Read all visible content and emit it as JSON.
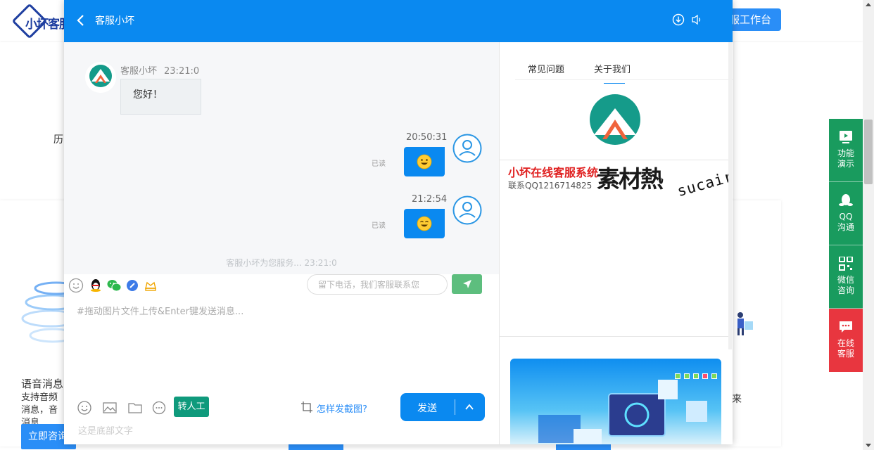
{
  "background_site": {
    "logo_text": "小坏客服",
    "console_button": "服工作台",
    "left_snippet": "历",
    "feature_title": "语音消息",
    "feature_desc": "支持音频消息，音消息",
    "consult_button": "立即咨询",
    "right_char": "来"
  },
  "float_bar": {
    "items": [
      {
        "icon": "play-icon",
        "label_1": "功能",
        "label_2": "演示"
      },
      {
        "icon": "qq-icon",
        "label_1": "QQ",
        "label_2": "沟通"
      },
      {
        "icon": "qr-code-icon",
        "label_1": "微信",
        "label_2": "咨询"
      },
      {
        "icon": "chat-icon",
        "label_1": "在线",
        "label_2": "客服"
      }
    ],
    "colors": {
      "green": "#199b5e",
      "red": "#e8363f"
    }
  },
  "chat": {
    "header": {
      "title": "客服小坏"
    },
    "messages": [
      {
        "side": "left",
        "sender": "客服小坏",
        "time": "23:21:0",
        "text": "您好！"
      },
      {
        "side": "right",
        "time": "20:50:31",
        "emoji": "grinning-emoji",
        "status": "已读"
      },
      {
        "side": "right",
        "time": "21:2:54",
        "emoji": "smiling-emoji",
        "status": "已读"
      }
    ],
    "service_note": "客服小坏为您服务... 23:21:0",
    "phone_placeholder": "留下电话，我们客服联系您",
    "message_placeholder": "#拖动图片文件上传&Enter键发送消息...",
    "manual_button": "转人工",
    "screenshot_link": "怎样发截图?",
    "send_button": "发送",
    "footer_text": "这是底部文字"
  },
  "right_panel": {
    "tabs": [
      "常见问题",
      "关于我们"
    ],
    "active_tab": 1,
    "about_title": "小坏在线客服系统",
    "about_qq": "联系QQ1216714825",
    "watermark_cn": "素材熱",
    "watermark_en": "sucaire.com"
  },
  "colors": {
    "primary": "#0a89f0",
    "message_bg": "#f6f7f9",
    "manual_btn": "#0f9a7c",
    "phone_send": "#5dbe7e"
  }
}
